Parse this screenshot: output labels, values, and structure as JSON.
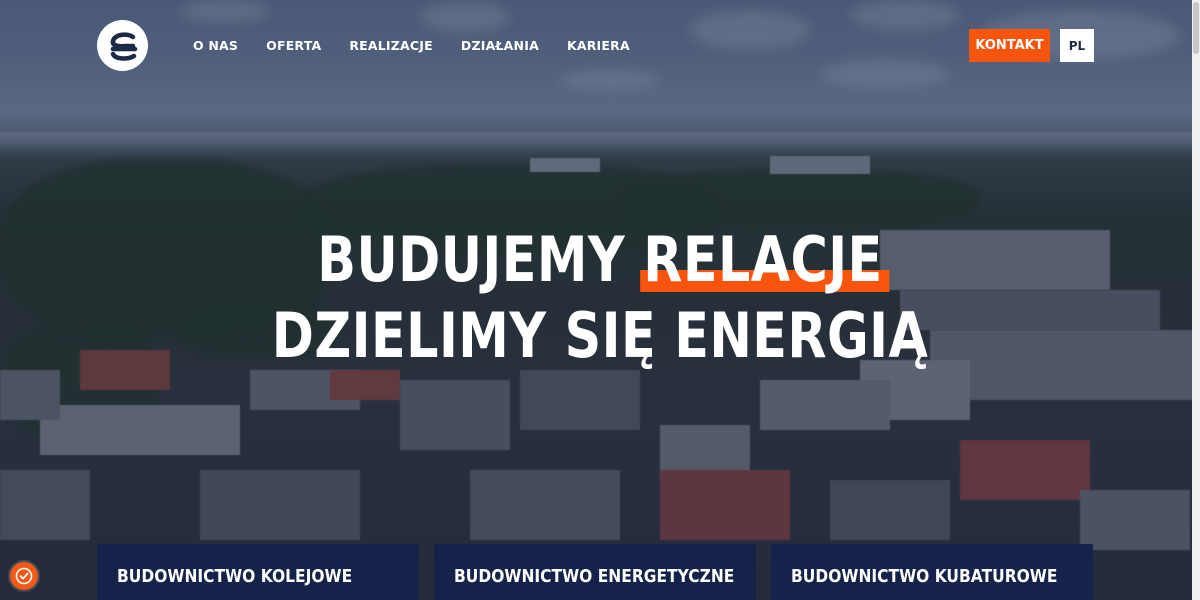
{
  "header": {
    "logo_icon": "brand-logo-e-icon",
    "nav": [
      {
        "label": "O NAS"
      },
      {
        "label": "OFERTA"
      },
      {
        "label": "REALIZACJE"
      },
      {
        "label": "DZIAŁANIA"
      },
      {
        "label": "KARIERA"
      }
    ],
    "contact_label": "KONTAKT",
    "language_label": "PL"
  },
  "hero": {
    "line1_prefix": "BUDUJEMY",
    "line1_accent": "RELACJE",
    "line2": "DZIELIMY SIĘ ENERGIĄ"
  },
  "cards": [
    {
      "label": "BUDOWNICTWO KOLEJOWE"
    },
    {
      "label": "BUDOWNICTWO ENERGETYCZNE"
    },
    {
      "label": "BUDOWNICTWO KUBATUROWE"
    }
  ],
  "colors": {
    "accent": "#f7540d",
    "navy": "#15234a",
    "white": "#ffffff"
  },
  "cookie_icon": "cookie-consent-icon"
}
